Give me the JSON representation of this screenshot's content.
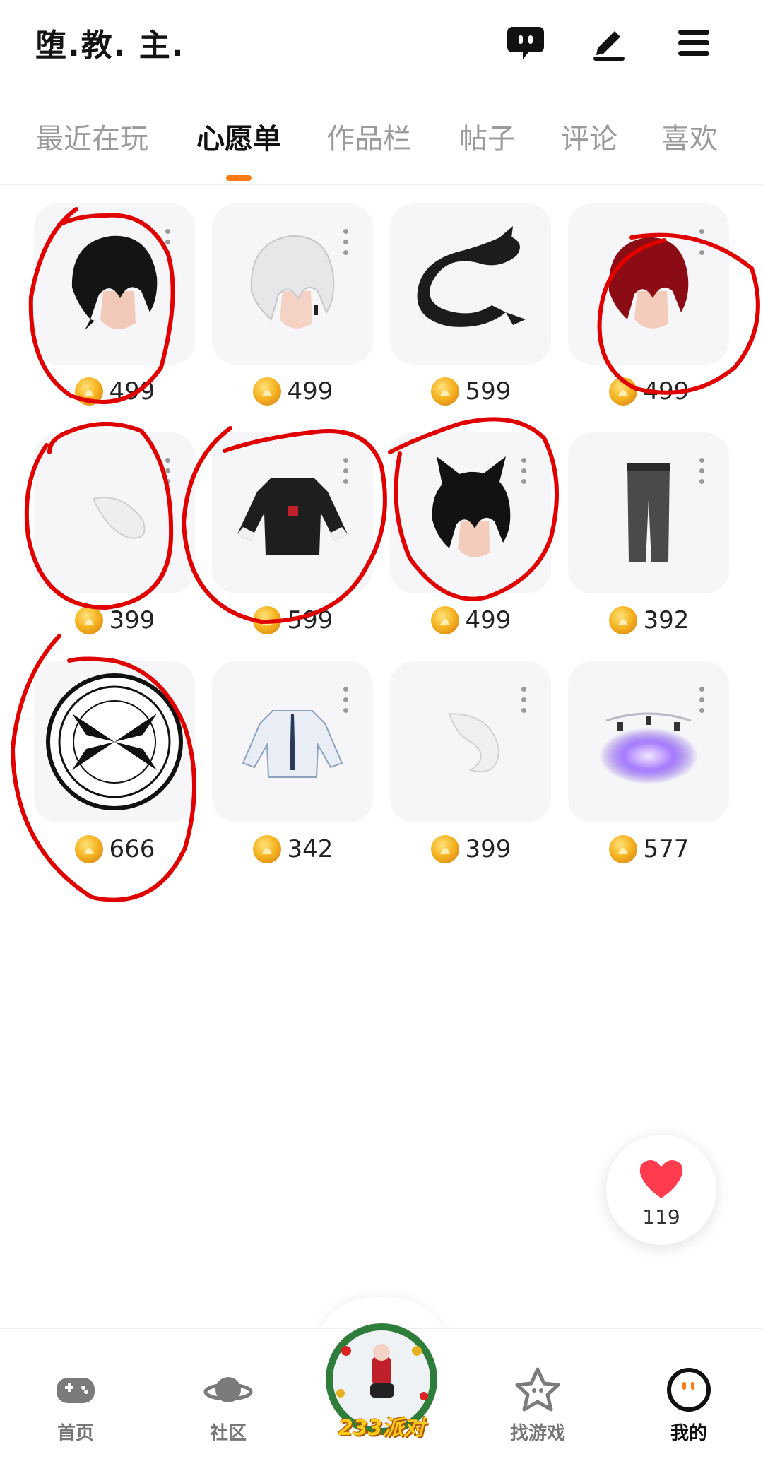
{
  "header": {
    "title": "堕.教. 主."
  },
  "tabs": [
    {
      "label": "最近在玩"
    },
    {
      "label": "心愿单"
    },
    {
      "label": "作品栏"
    },
    {
      "label": "帖子"
    },
    {
      "label": "评论"
    },
    {
      "label": "喜欢"
    }
  ],
  "active_tab": "心愿单",
  "items": [
    {
      "icon": "black-hair",
      "price": "499"
    },
    {
      "icon": "white-hair",
      "price": "499"
    },
    {
      "icon": "black-dragon",
      "price": "599"
    },
    {
      "icon": "red-hair",
      "price": "499"
    },
    {
      "icon": "white-tail",
      "price": "399"
    },
    {
      "icon": "black-jacket",
      "price": "599"
    },
    {
      "icon": "cat-ear-hair",
      "price": "499"
    },
    {
      "icon": "gray-pants",
      "price": "392"
    },
    {
      "icon": "magic-circle",
      "price": "666"
    },
    {
      "icon": "white-shirt",
      "price": "342"
    },
    {
      "icon": "white-fur-tail",
      "price": "399"
    },
    {
      "icon": "purple-aura",
      "price": "577"
    }
  ],
  "likes": {
    "count": "119"
  },
  "bottom_nav": [
    {
      "label": "首页"
    },
    {
      "label": "社区"
    },
    {
      "label": "233派对"
    },
    {
      "label": "找游戏"
    },
    {
      "label": "我的"
    }
  ],
  "colors": {
    "accent": "#ff7a14",
    "annotation": "#e00000",
    "coin": "#f5b31f"
  }
}
